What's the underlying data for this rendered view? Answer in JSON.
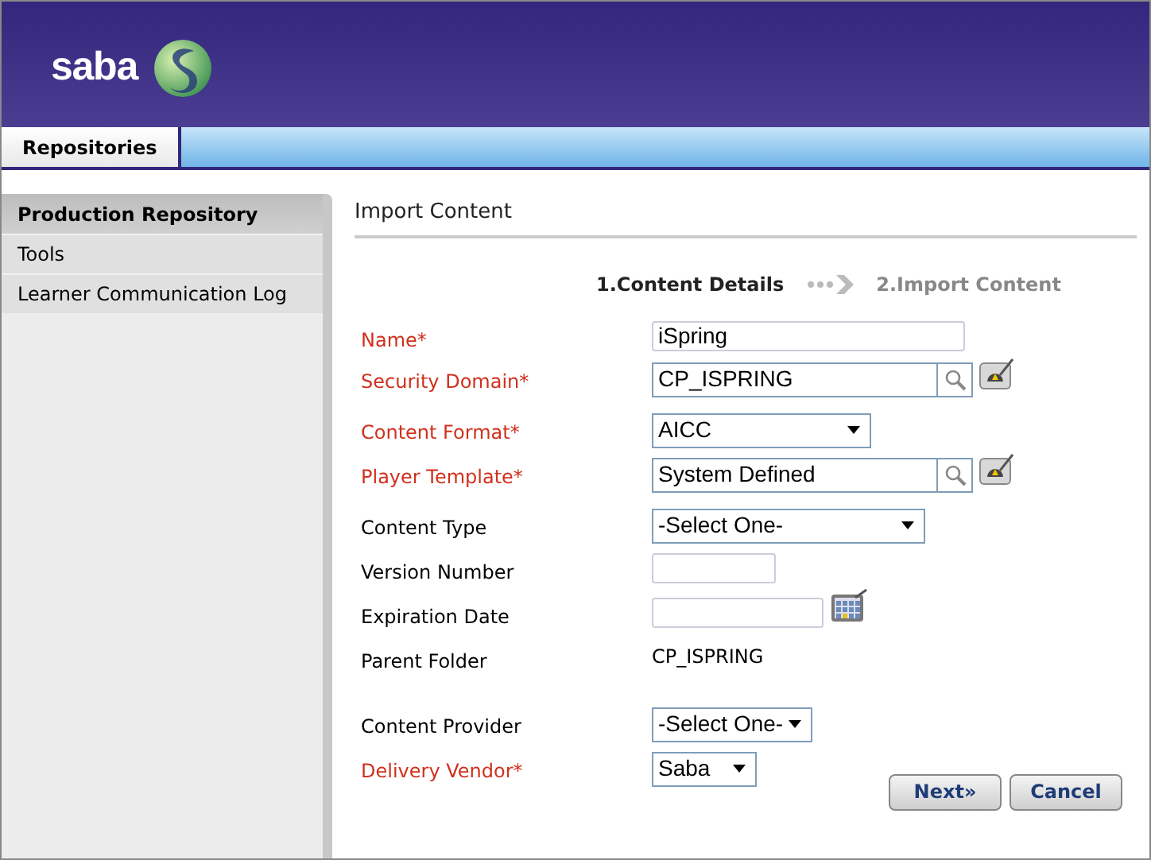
{
  "header": {
    "logo_text": "saba"
  },
  "tabs": [
    {
      "label": "Repositories",
      "selected": true
    }
  ],
  "sidebar": {
    "items": [
      {
        "label": "Production Repository",
        "selected": true
      },
      {
        "label": "Tools",
        "selected": false
      },
      {
        "label": "Learner Communication Log",
        "selected": false
      }
    ]
  },
  "main": {
    "title": "Import Content",
    "steps": [
      {
        "label": "1.Content Details",
        "selected": true
      },
      {
        "label": "2.Import Content",
        "selected": false
      }
    ],
    "fields": [
      {
        "label": "Name*",
        "required": true,
        "kind": "text",
        "value": "iSpring"
      },
      {
        "label": "Security Domain*",
        "required": true,
        "kind": "lookup",
        "value": "CP_ISPRING"
      },
      {
        "label": "Content Format*",
        "required": true,
        "kind": "select",
        "value": "AICC"
      },
      {
        "label": "Player Template*",
        "required": true,
        "kind": "lookup",
        "value": "System Defined"
      },
      {
        "label": "Content Type",
        "required": false,
        "kind": "select",
        "value": "-Select One-"
      },
      {
        "label": "Version Number",
        "required": false,
        "kind": "text"
      },
      {
        "label": "Expiration Date",
        "required": false,
        "kind": "date"
      },
      {
        "label": "Parent Folder",
        "required": false,
        "kind": "static",
        "value": "CP_ISPRING"
      },
      {
        "label": "Content Provider",
        "required": false,
        "kind": "select",
        "value": "-Select One-"
      },
      {
        "label": "Delivery Vendor*",
        "required": true,
        "kind": "select",
        "value": "Saba"
      }
    ],
    "buttons": [
      "Next»",
      "Cancel"
    ]
  }
}
